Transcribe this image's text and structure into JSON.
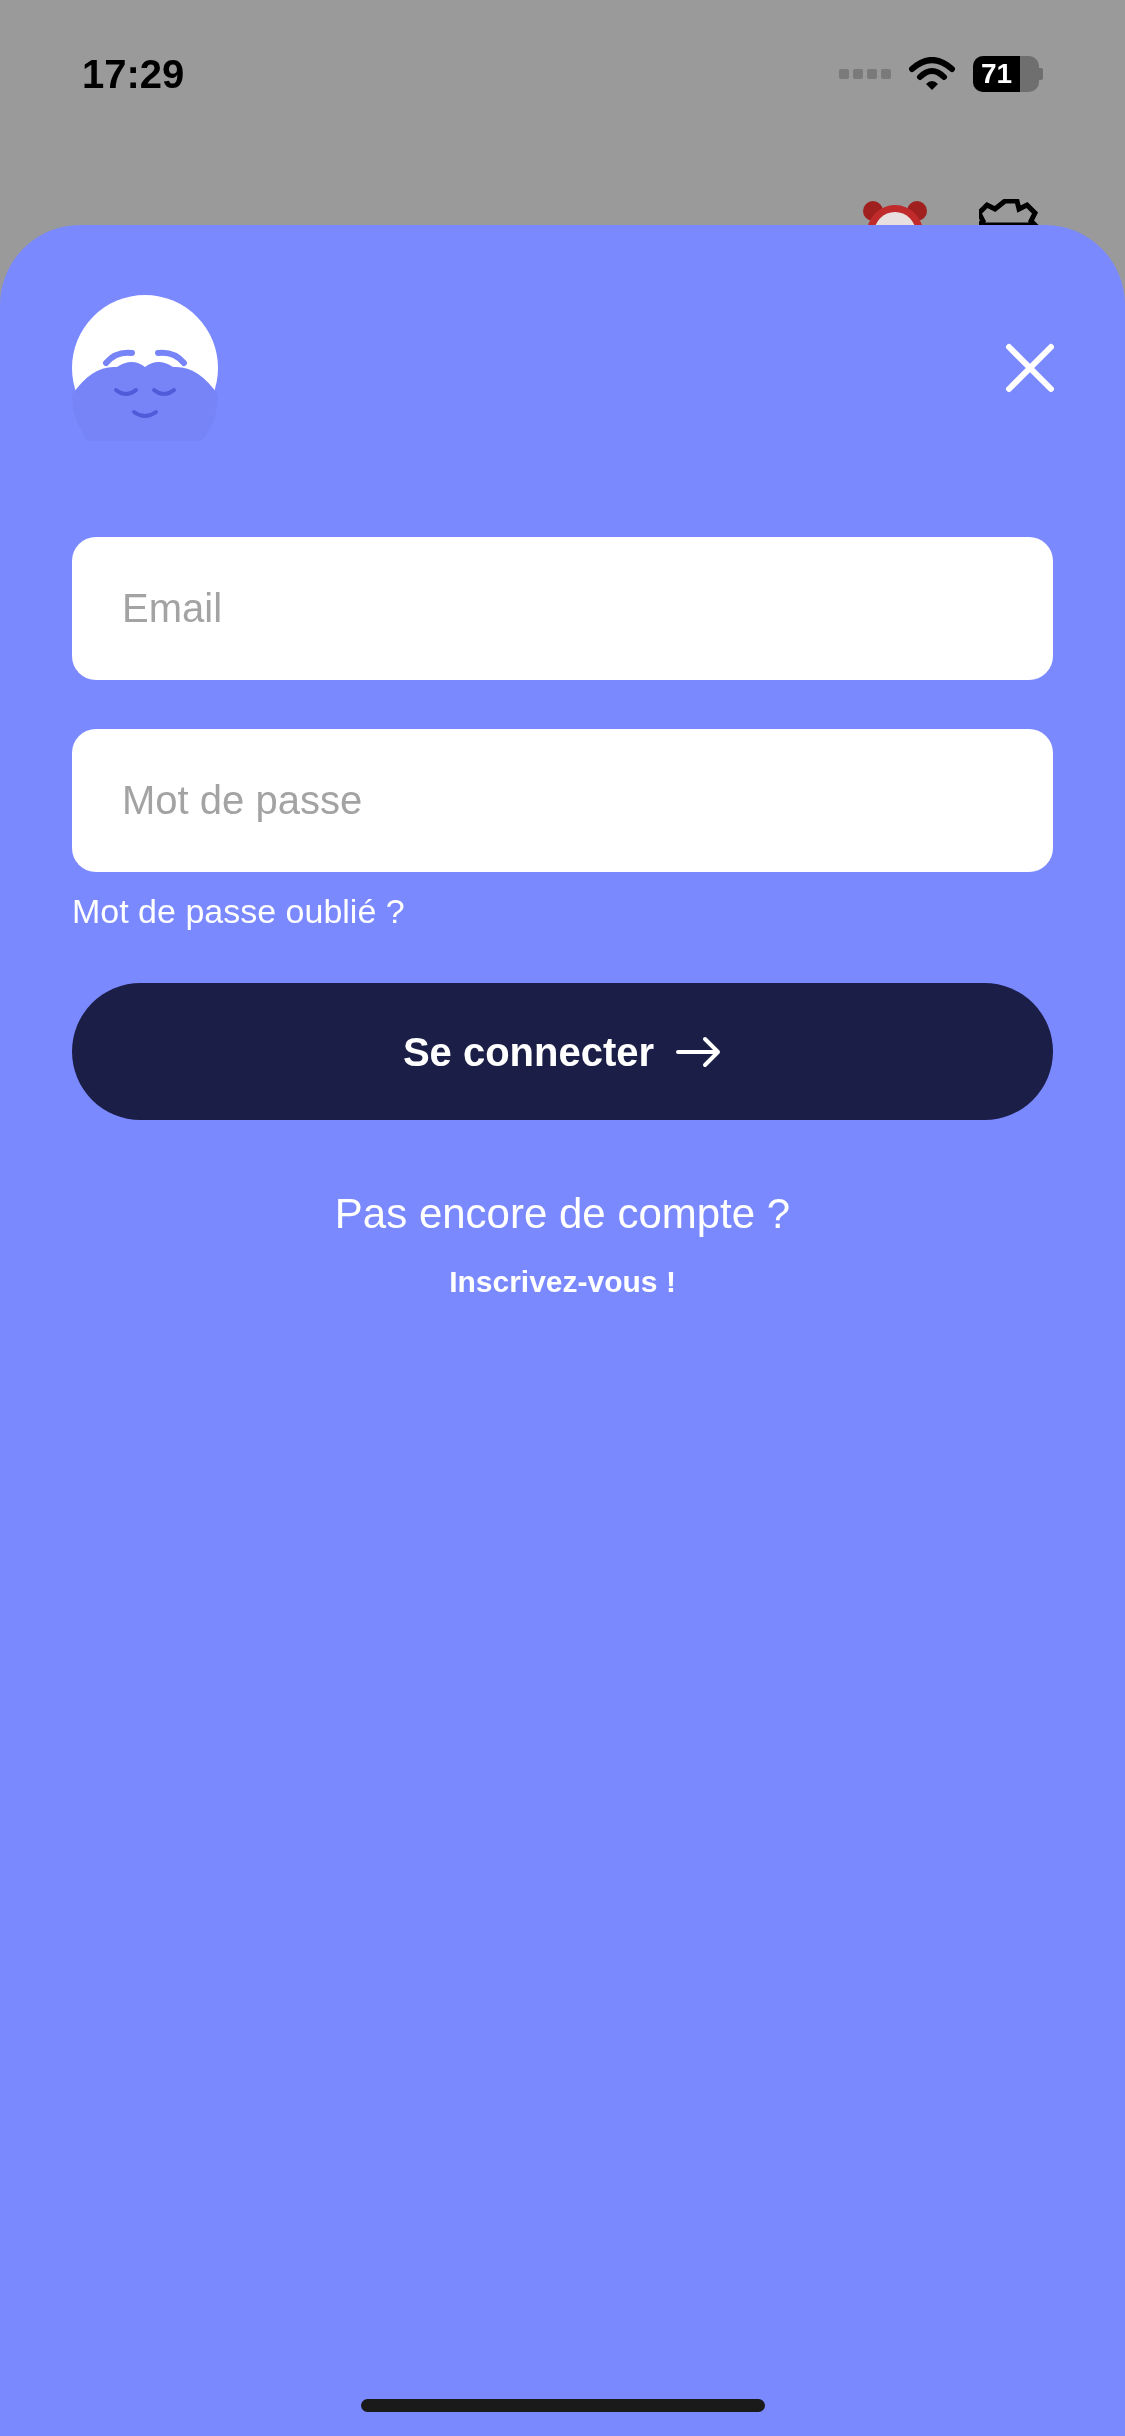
{
  "status_bar": {
    "time": "17:29",
    "battery": "71"
  },
  "login_sheet": {
    "fields": [
      {
        "placeholder": "Email"
      },
      {
        "placeholder": "Mot de passe"
      }
    ],
    "forgot_link": "Mot de passe oublié ?",
    "submit_button": "Se connecter",
    "signup_prompt": "Pas encore de compte ?",
    "signup_link": "Inscrivez-vous !"
  }
}
